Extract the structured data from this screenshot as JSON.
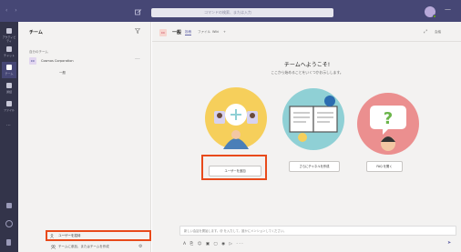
{
  "search": {
    "placeholder": "コマンドの検索、または入力"
  },
  "rail": {
    "items": [
      {
        "label": "アクティビティ",
        "icon": "bell-icon"
      },
      {
        "label": "チャット",
        "icon": "chat-icon"
      },
      {
        "label": "チーム",
        "icon": "teams-icon",
        "active": true
      },
      {
        "label": "通話",
        "icon": "phone-icon"
      },
      {
        "label": "ファイル",
        "icon": "file-icon"
      }
    ]
  },
  "teams_panel": {
    "title": "チーム",
    "section": "自分のチーム",
    "team": {
      "abbr": "CC",
      "name": "Cosmos Corporation"
    },
    "channel": "一般",
    "invite_label": "ユーザーを招待",
    "join_label": "チームに参加、またはチームを作成"
  },
  "header": {
    "badge": "CC",
    "title": "一般",
    "tabs": [
      "投稿",
      "ファイル",
      "Wiki",
      "+"
    ],
    "right_label": "会議"
  },
  "welcome": {
    "title": "チームへようこそ!",
    "subtitle": "ここから始めることをいくつかお示しします。"
  },
  "actions": {
    "add_people": "ユーザーを追加",
    "create_channel": "さらにチャネルを作成",
    "open_faq": "FAQ を開く"
  },
  "compose": {
    "placeholder": "新しい会話を開始します。@ を入力して、誰かにメンションしてください。"
  },
  "colors": {
    "titlebar": "#464775",
    "rail": "#33344a",
    "highlight": "#e84a1b",
    "accent": "#6264a7"
  }
}
